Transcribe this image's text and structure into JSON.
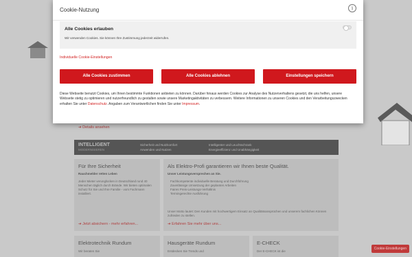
{
  "modal": {
    "title": "Cookie-Nutzung",
    "info_icon": "i",
    "all_cookies": {
      "title": "Alle Cookies erlauben",
      "description": "Wir verwenden Cookies. Sie können Ihre Zustimmung jederzeit widerrufen.",
      "toggle_state": "off"
    },
    "individual_link": "Individuelle Cookie-Einstellungen",
    "buttons": {
      "accept_all": "Alle Cookies zustimmen",
      "reject_all": "Alle Cookies ablehnen",
      "save_settings": "Einstellungen speichern"
    },
    "disclaimer": {
      "part1": "Diese Webseite benutzt Cookies, um Ihnen bestimmte Funktionen anbieten zu können. Darüber hinaus werden Cookies zur Analyse des Nutzerverhaltens gesetzt, die uns helfen, unsere Webseite stetig zu optimieren und nutzerfreundlich zu gestalten sowie unsere Marketingaktivitäten zu verbessern. Weitere Informationen zu unseren Cookies und den Verarbeitungszwecken erhalten Sie unter ",
      "privacy_link": "Datenschutz",
      "part2": ". Angaben zum Verantwortlichen finden Sie unter ",
      "imprint_link": "Impressum",
      "part3": "."
    },
    "accent_color": "#d0181d"
  },
  "background": {
    "details_link": "➔ Details ansehen",
    "bar": {
      "brand": "INTELLIGENT",
      "brand_sub": "MODERNISIEREN",
      "col1_line1": "Sicherheit und Nutzkomfort",
      "col1_line2": "Anwenden und Nutzen",
      "col2_line1": "Intelligenter und Leuchtschrank",
      "col2_line2": "Energieeffizienz und Unabhängigkeit"
    },
    "box1": {
      "title": "Für Ihre Sicherheit",
      "subtitle": "Rauchmelder retten Leben",
      "text": "Jeder Mieter verunglücken in Deutschland rund 40 Menschen täglich durch Brände. Wir bieten optimalen Schutz für Sie und Ihre Familie - vom Fachmann installiert.",
      "link": "➔ Jetzt absichern - mehr erfahren..."
    },
    "box2": {
      "title": "Als Elektro-Profi garantieren wir Ihnen beste Qualität.",
      "subtitle": "Unser Leistungsversprechen an Sie.",
      "items": [
        "Fachkompetente individuelle Beratung und Durchführung",
        "Zuverlässige Umsetzung der geplanten Arbeiten",
        "Faires Preis-Leistungs-Verhältnis",
        "Termingerechte Ausführung"
      ],
      "motto": "Unser Motto lautet: Den Kunden mit hochwertigem Einsatz an Qualitätsansprüchen und unserem fachlichen Können zufrieden zu stellen.",
      "link": "➔ Erfahren Sie mehr über uns..."
    },
    "box3": {
      "title": "Elektrotechnik Rundum",
      "text": "Wir beraten Sie"
    },
    "box4": {
      "title": "Hausgeräte Rundum",
      "text": "Entdecken Sie Trends und"
    },
    "box5": {
      "title": "E-CHECK",
      "text": "Der E-CHECK ist die"
    },
    "cookie_settings_button": "Cookie-Einstellungen"
  }
}
